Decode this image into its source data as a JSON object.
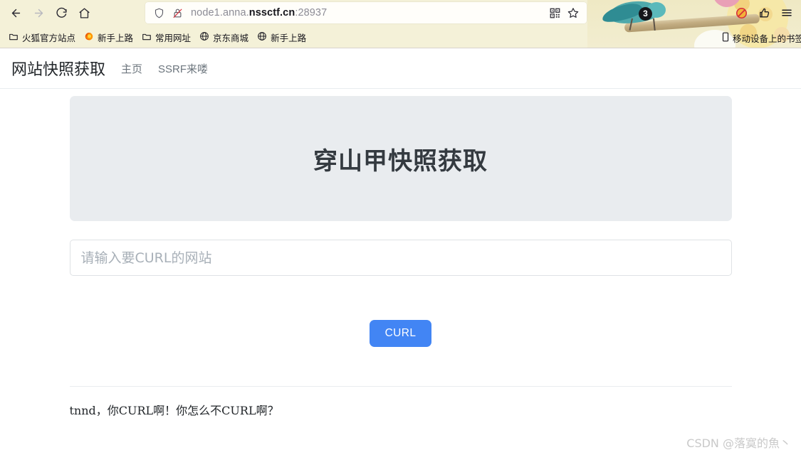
{
  "browser": {
    "nav_buttons": [
      {
        "name": "back-button",
        "glyph": "back-arrow-icon"
      },
      {
        "name": "forward-button",
        "glyph": "forward-arrow-icon"
      },
      {
        "name": "reload-button",
        "glyph": "reload-icon"
      },
      {
        "name": "home-button",
        "glyph": "home-icon"
      }
    ],
    "urlbar": {
      "shield_icon": "shield-icon",
      "lock_icon": "lock-crossed-icon",
      "url_prefix": "node1.anna.",
      "url_domain": "nssctf.cn",
      "url_suffix": ":28937",
      "full_url": "node1.anna.nssctf.cn:28937",
      "qr_icon": "qr-code-icon",
      "star_icon": "star-bookmark-icon"
    },
    "toolbar_icons": [
      {
        "name": "extension-blocked-icon",
        "label": "blocked"
      },
      {
        "name": "thumbs-up-icon",
        "label": "thumbs-up"
      },
      {
        "name": "app-menu-icon",
        "label": "menu"
      }
    ],
    "theme_badge": "3",
    "bookmarks": [
      {
        "label": "火狐官方站点",
        "icon": "folder-icon"
      },
      {
        "label": "新手上路",
        "icon": "firefox-icon"
      },
      {
        "label": "常用网址",
        "icon": "folder-icon"
      },
      {
        "label": "京东商城",
        "icon": "globe-icon"
      },
      {
        "label": "新手上路",
        "icon": "globe-icon"
      }
    ],
    "mobile_bookmarks": {
      "label": "移动设备上的书签",
      "icon": "mobile-phone-icon"
    }
  },
  "site": {
    "navbar": {
      "brand": "网站快照获取",
      "links": [
        {
          "label": "主页"
        },
        {
          "label": "SSRF来喽"
        }
      ]
    },
    "jumbotron": {
      "title": "穿山甲快照获取"
    },
    "form": {
      "input_placeholder": "请输入要CURL的网站",
      "input_value": "",
      "submit_label": "CURL"
    },
    "result": {
      "text": "tnnd，你CURL啊！你怎么不CURL啊？"
    }
  },
  "watermark": {
    "text": "CSDN @落寞的魚丶"
  },
  "colors": {
    "accent_blue": "#4285f4",
    "jumbotron_bg": "#e9ecef",
    "chrome_bg": "#f4f1d8",
    "nav_link": "#6c757d"
  }
}
